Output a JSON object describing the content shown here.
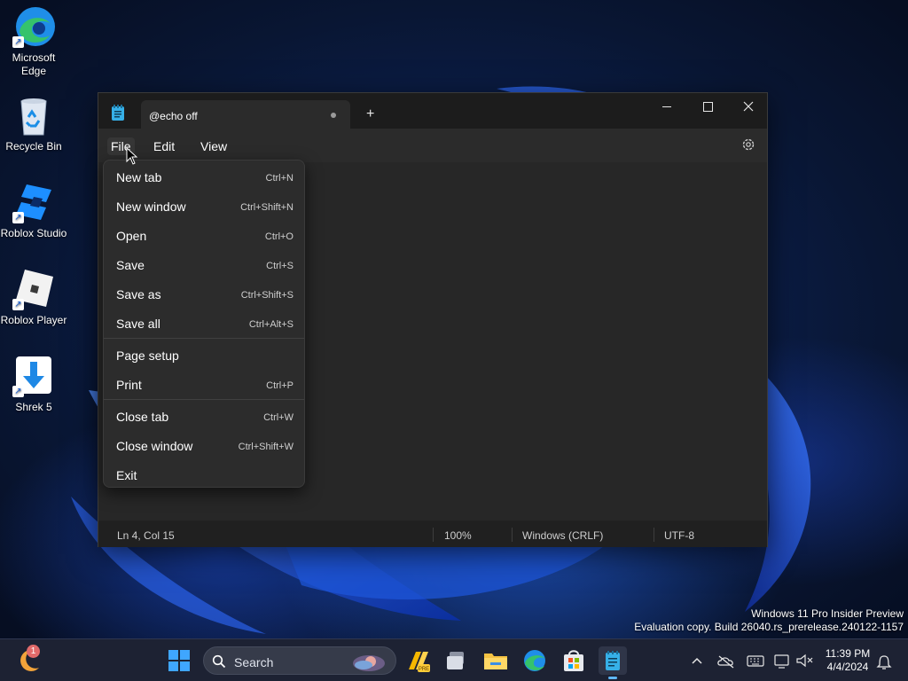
{
  "desktop": {
    "icons": [
      {
        "label": "Microsoft\nEdge",
        "icon": "edge-icon"
      },
      {
        "label": "Recycle Bin",
        "icon": "recycle-bin-icon"
      },
      {
        "label": "Roblox Studio",
        "icon": "roblox-studio-icon"
      },
      {
        "label": "Roblox Player",
        "icon": "roblox-player-icon"
      },
      {
        "label": "Shrek 5",
        "icon": "download-arrow-icon"
      }
    ]
  },
  "notepad": {
    "tab_title": "@echo off",
    "new_tab_symbol": "+",
    "menus": {
      "file": "File",
      "edit": "Edit",
      "view": "View"
    },
    "status": {
      "position": "Ln 4, Col 15",
      "zoom": "100%",
      "line_endings": "Windows (CRLF)",
      "encoding": "UTF-8"
    }
  },
  "file_menu": {
    "items": [
      {
        "label": "New tab",
        "shortcut": "Ctrl+N"
      },
      {
        "label": "New window",
        "shortcut": "Ctrl+Shift+N"
      },
      {
        "label": "Open",
        "shortcut": "Ctrl+O"
      },
      {
        "label": "Save",
        "shortcut": "Ctrl+S"
      },
      {
        "label": "Save as",
        "shortcut": "Ctrl+Shift+S"
      },
      {
        "label": "Save all",
        "shortcut": "Ctrl+Alt+S"
      },
      {
        "label": "Page setup",
        "shortcut": ""
      },
      {
        "label": "Print",
        "shortcut": "Ctrl+P"
      },
      {
        "label": "Close tab",
        "shortcut": "Ctrl+W"
      },
      {
        "label": "Close window",
        "shortcut": "Ctrl+Shift+W"
      },
      {
        "label": "Exit",
        "shortcut": ""
      }
    ]
  },
  "watermark": {
    "line1": "Windows 11 Pro Insider Preview",
    "line2": "Evaluation copy. Build 26040.rs_prerelease.240122-1157"
  },
  "taskbar": {
    "search_label": "Search",
    "weather_badge": "1",
    "time": "11:39 PM",
    "date": "4/4/2024",
    "pinned": [
      "start-icon",
      "copilot-icon",
      "task-view-icon",
      "file-explorer-icon",
      "edge-icon",
      "store-icon",
      "notepad-icon"
    ]
  },
  "colors": {
    "accent": "#5fb8ff",
    "window_bg": "#202020",
    "menu_bg": "#2c2c2c"
  }
}
